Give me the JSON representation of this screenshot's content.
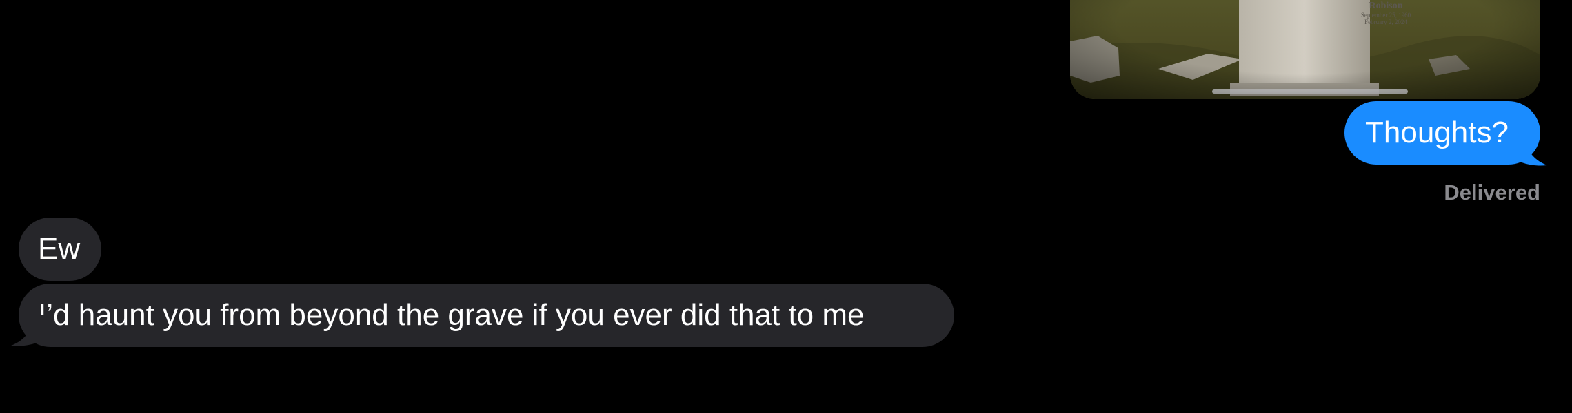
{
  "conversation": {
    "attachment": {
      "kind": "photo",
      "depicts": "gravestone-icon",
      "engraving": {
        "name": "Robison",
        "date_line_1": "September 25, 1960",
        "date_line_2": "February 2, 2024"
      }
    },
    "messages": [
      {
        "direction": "outgoing",
        "text": "Thoughts?"
      },
      {
        "direction": "incoming",
        "text": "Ew"
      },
      {
        "direction": "incoming",
        "text": "I’d haunt you from beyond the grave if you ever did that to me"
      }
    ],
    "delivery_status": "Delivered"
  },
  "colors": {
    "background": "#000000",
    "outgoing_bubble": "#1a8cff",
    "incoming_bubble": "#26262a",
    "status_text": "#8a8a8e"
  }
}
